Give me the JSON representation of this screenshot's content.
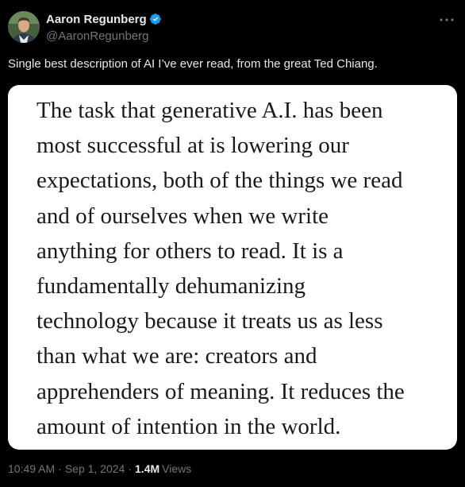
{
  "author": {
    "display_name": "Aaron Regunberg",
    "handle": "@AaronRegunberg",
    "verified_color": "#1d9bf0"
  },
  "icons": {
    "verified": "verified-badge-icon",
    "more": "more-horizontal-icon"
  },
  "tweet": {
    "text": "Single best description of AI I’ve ever read, from the great Ted Chiang."
  },
  "quote_image": {
    "lines": [
      "The task that generative A.I. has been",
      "most successful at is lowering our",
      "expectations, both of the things we read",
      "and of ourselves when we write",
      "anything for others to read. It is a",
      "fundamentally dehumanizing",
      "technology because it treats us as less",
      "than what we are: creators and",
      "apprehenders of meaning. It reduces the",
      "amount of intention in the world."
    ]
  },
  "meta": {
    "time": "10:49 AM",
    "separator": "·",
    "date": "Sep 1, 2024",
    "views_count": "1.4M",
    "views_label": "Views"
  },
  "colors": {
    "background": "#000000",
    "primary_text": "#e7e9ea",
    "secondary_text": "#71767b",
    "quote_text": "#1a1a1a",
    "image_background": "#ffffff"
  }
}
